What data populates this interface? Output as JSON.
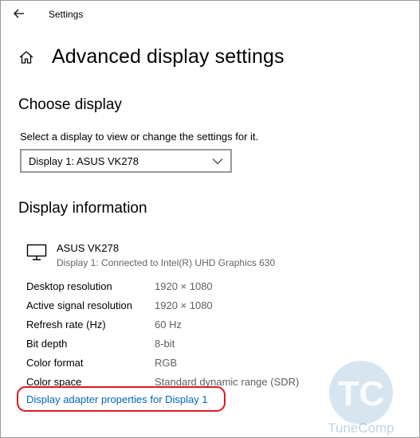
{
  "titlebar": {
    "app_title": "Settings",
    "back_icon": "back-arrow-icon"
  },
  "header": {
    "home_icon": "home-icon",
    "title": "Advanced display settings"
  },
  "choose_display": {
    "heading": "Choose display",
    "description": "Select a display to view or change the settings for it.",
    "selected": "Display 1: ASUS VK278"
  },
  "display_info": {
    "heading": "Display information",
    "monitor_icon": "monitor-icon",
    "monitor_name": "ASUS VK278",
    "monitor_connection": "Display 1: Connected to Intel(R) UHD Graphics 630",
    "rows": [
      {
        "label": "Desktop resolution",
        "value": "1920 × 1080"
      },
      {
        "label": "Active signal resolution",
        "value": "1920 × 1080"
      },
      {
        "label": "Refresh rate (Hz)",
        "value": "60 Hz"
      },
      {
        "label": "Bit depth",
        "value": "8-bit"
      },
      {
        "label": "Color format",
        "value": "RGB"
      },
      {
        "label": "Color space",
        "value": "Standard dynamic range (SDR)"
      }
    ],
    "adapter_link": "Display adapter properties for Display 1"
  },
  "watermark": {
    "letters": "TC",
    "brand": "TuneComp"
  },
  "colors": {
    "link": "#0067b8",
    "highlight_border": "#e0191e",
    "secondary_text": "#666666"
  }
}
